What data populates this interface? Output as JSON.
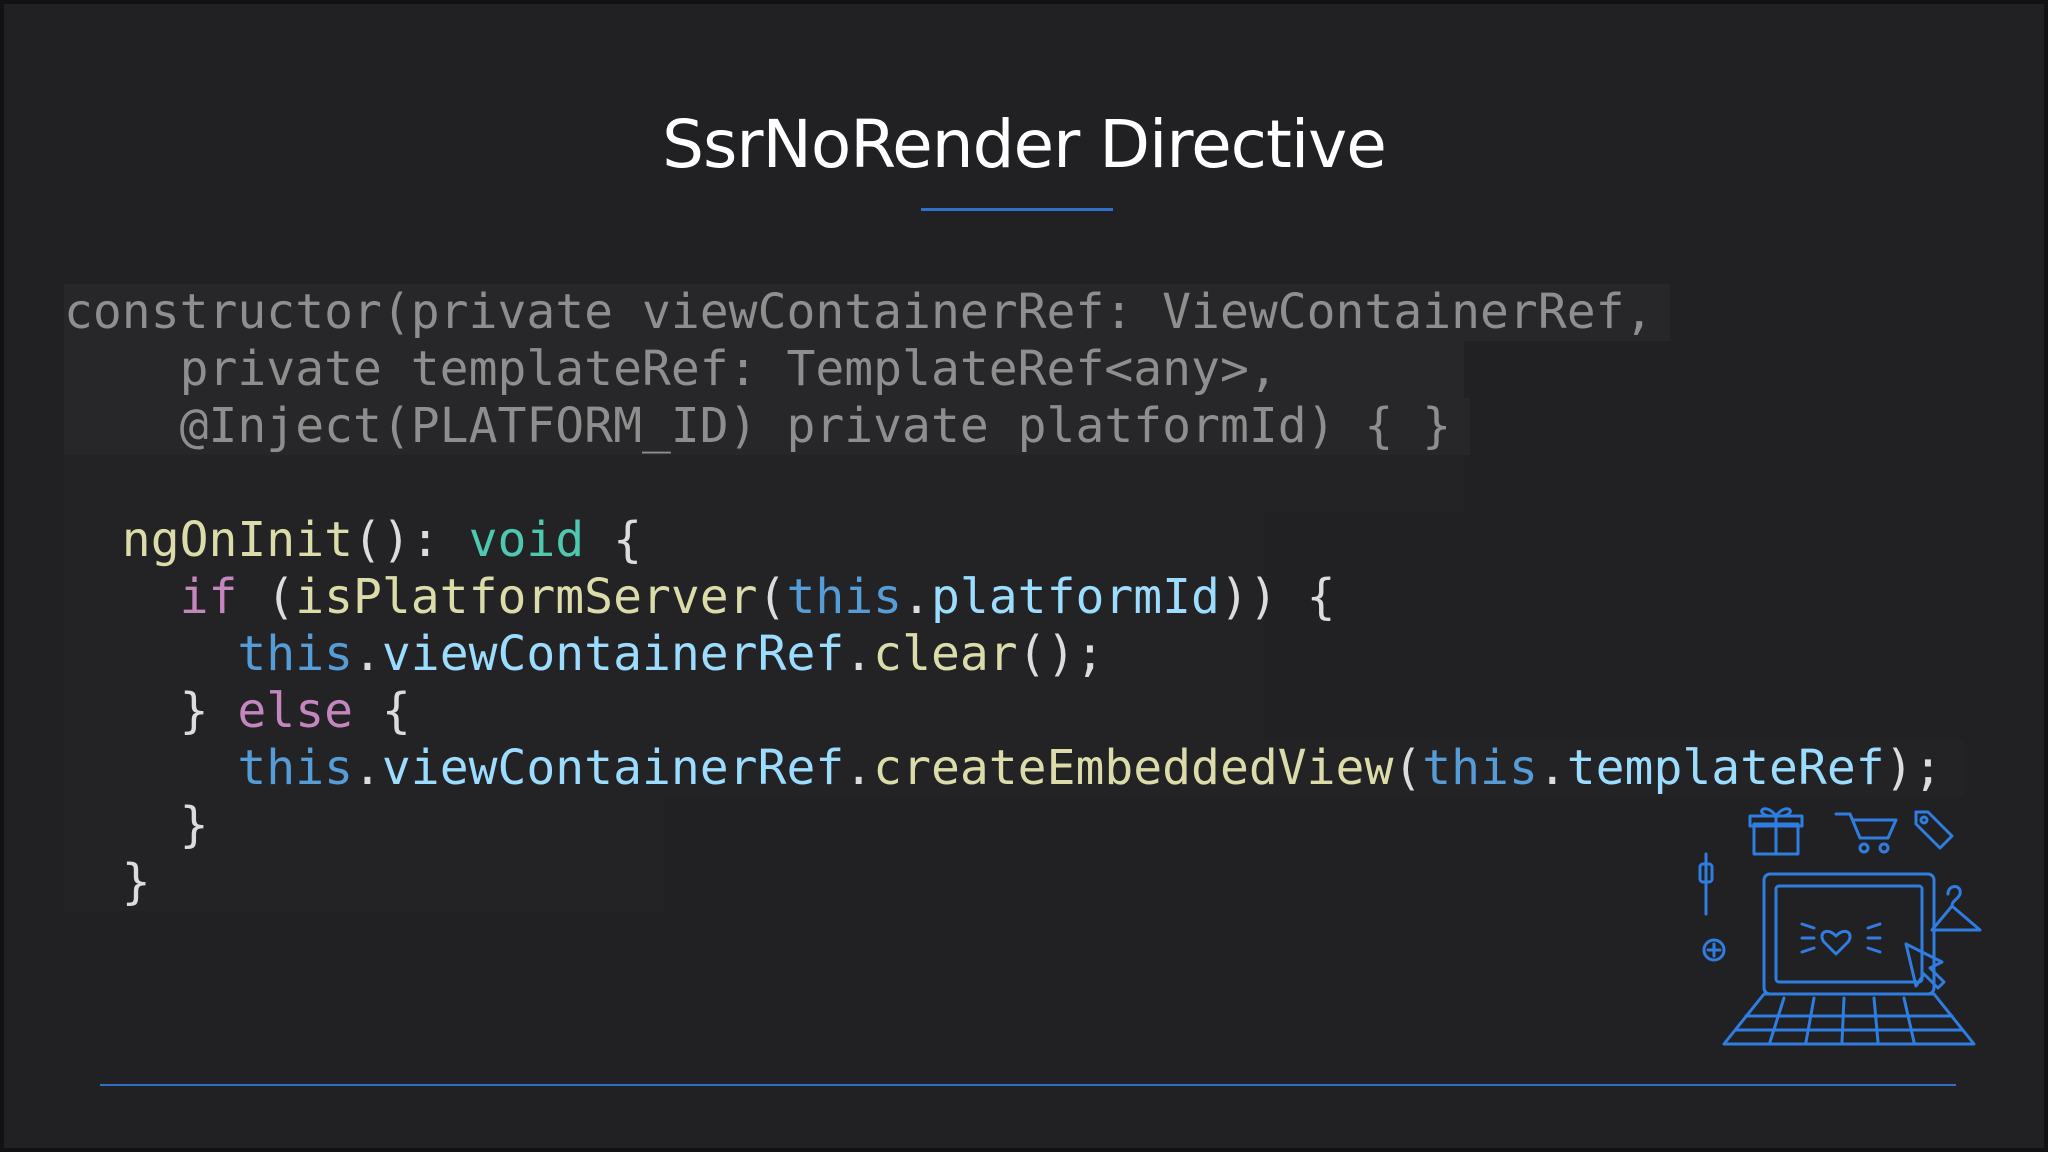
{
  "slide": {
    "title": "SsrNoRender Directive"
  },
  "code": {
    "constructor_lines": [
      "constructor(private viewContainerRef: ViewContainerRef,",
      "    private templateRef: TemplateRef<any>,",
      "    @Inject(PLATFORM_ID) private platformId) { }"
    ],
    "ngoninit": {
      "fn": "ngOnInit",
      "sig_open": "(): ",
      "ret_type": "void",
      "brace_open": " {"
    },
    "if_line": {
      "kw": "if",
      "open": " (",
      "fn": "isPlatformServer",
      "paren": "(",
      "this": "this",
      "dot": ".",
      "prop": "platformId",
      "close": ")) {"
    },
    "clear_line": {
      "this": "this",
      "dot1": ".",
      "prop": "viewContainerRef",
      "dot2": ".",
      "fn": "clear",
      "tail": "();"
    },
    "else_line": {
      "brace": "} ",
      "kw": "else",
      "tail": " {"
    },
    "create_line": {
      "this1": "this",
      "dot1": ".",
      "prop1": "viewContainerRef",
      "dot2": ".",
      "fn": "createEmbeddedView",
      "paren": "(",
      "this2": "this",
      "dot3": ".",
      "prop2": "templateRef",
      "tail": ");"
    },
    "close_inner": "}",
    "close_outer": "}"
  },
  "colors": {
    "background": "#212123",
    "accent": "#2f6fc9",
    "keyword": "#c586c0",
    "this": "#569cd6",
    "type": "#4ec9b0",
    "function": "#dcdcaa",
    "property": "#9cdcfe",
    "dimmed": "#8e8e8e"
  },
  "illustration": {
    "icon": "laptop-shopping-icon"
  }
}
